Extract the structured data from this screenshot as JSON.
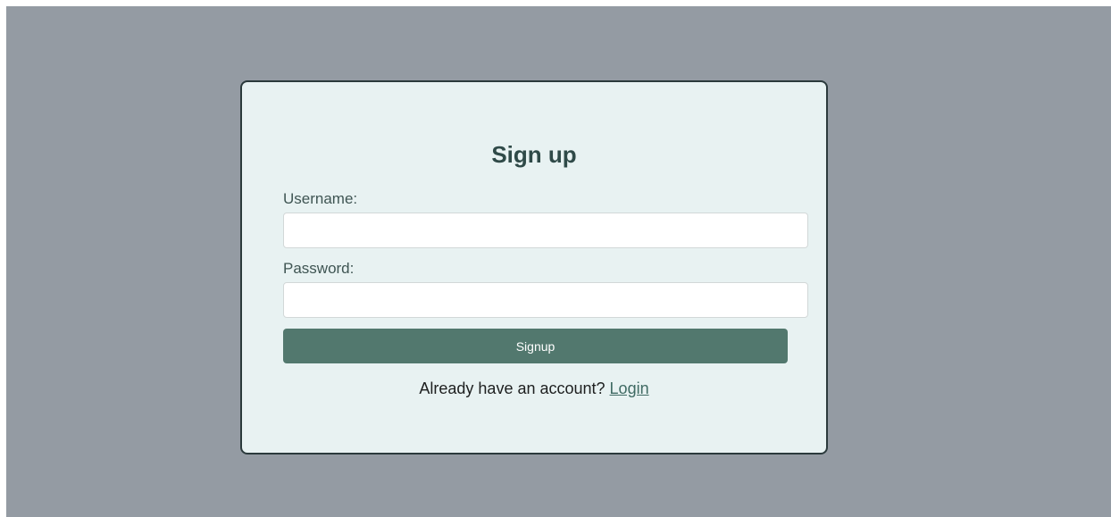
{
  "page": {
    "background_color": "#949ba3"
  },
  "card": {
    "background_color": "#e8f2f2",
    "border_color": "#2b3a3c"
  },
  "form": {
    "title": "Sign up",
    "username_label": "Username:",
    "username_value": "",
    "password_label": "Password:",
    "password_value": "",
    "submit_label": "Signup",
    "submit_color": "#52786e"
  },
  "footer": {
    "prompt_text": "Already have an account? ",
    "login_link_label": "Login"
  }
}
